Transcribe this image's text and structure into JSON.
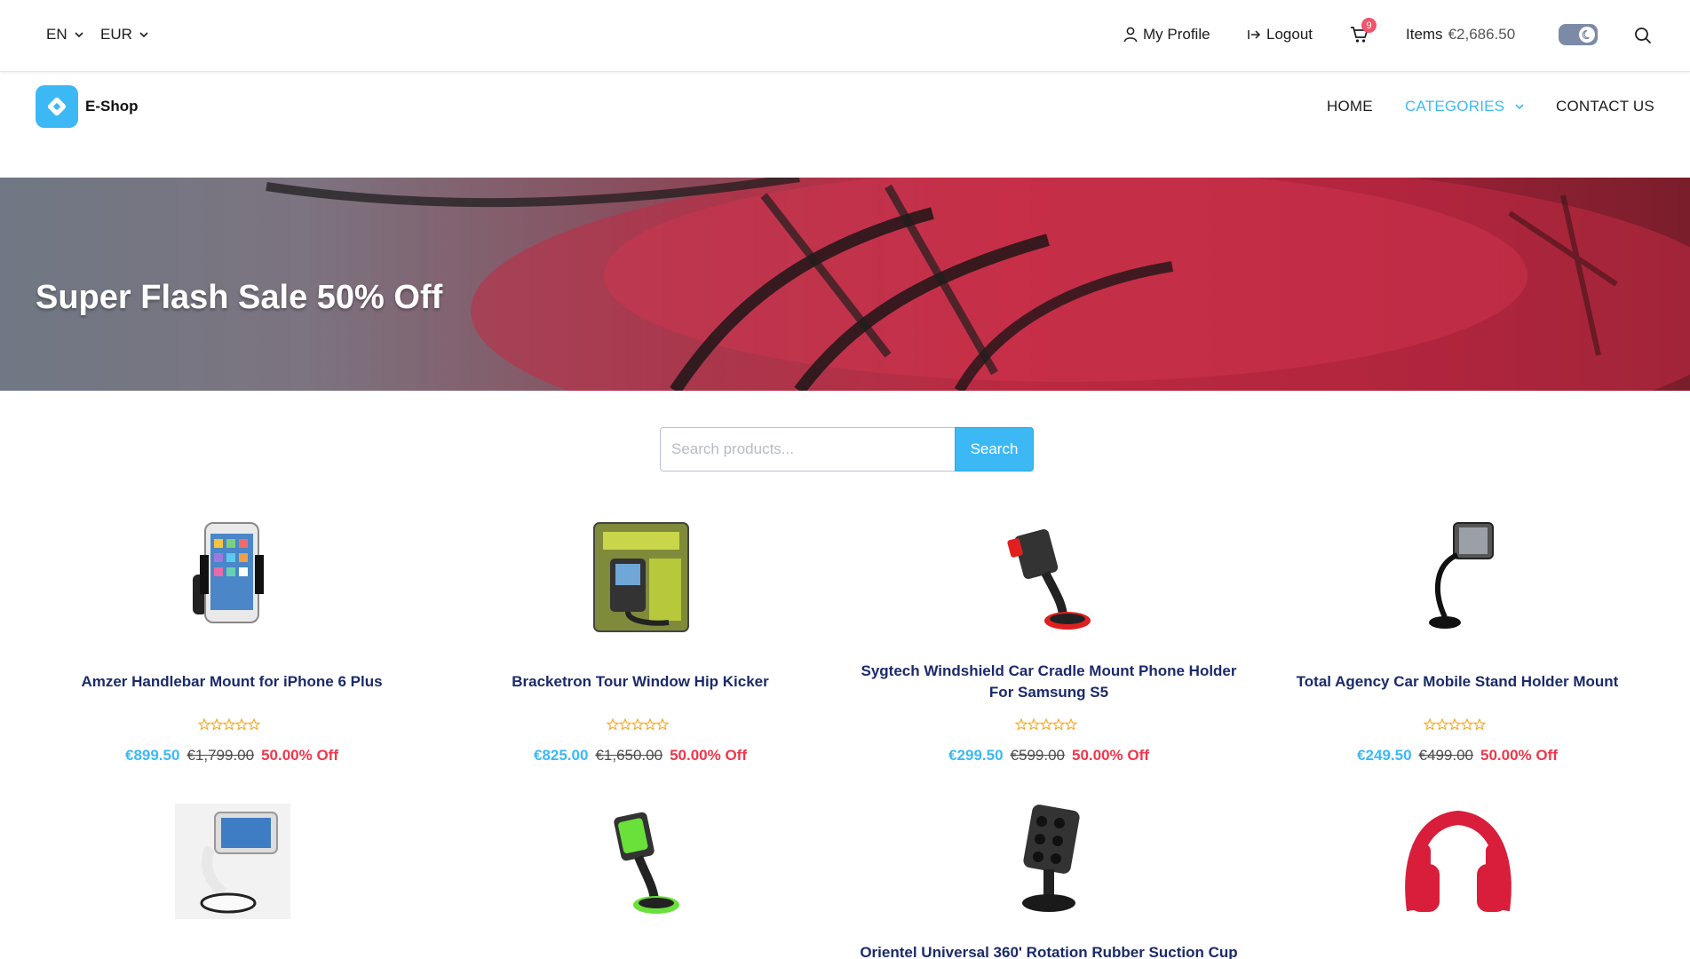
{
  "topbar": {
    "language": "EN",
    "currency": "EUR",
    "profile_label": "My Profile",
    "logout_label": "Logout",
    "cart_count": "9",
    "items_label": "Items",
    "items_total": "€2,686.50"
  },
  "header": {
    "logo_text": "E-Shop",
    "nav": {
      "home": "HOME",
      "categories": "CATEGORIES",
      "contact": "CONTACT US"
    }
  },
  "banner": {
    "title": "Super Flash Sale 50% Off"
  },
  "search": {
    "placeholder": "Search products...",
    "button_label": "Search"
  },
  "colors": {
    "accent": "#3cb9f5",
    "discount": "#f0374b",
    "title": "#1b2a6b",
    "badge": "#f0556b"
  },
  "products": [
    {
      "title": "Amzer Handlebar Mount for iPhone 6 Plus",
      "price": "€899.50",
      "old_price": "€1,799.00",
      "discount": "50.00% Off"
    },
    {
      "title": "Bracketron Tour Window Hip Kicker",
      "price": "€825.00",
      "old_price": "€1,650.00",
      "discount": "50.00% Off"
    },
    {
      "title": "Sygtech Windshield Car Cradle Mount Phone Holder For Samsung S5",
      "price": "€299.50",
      "old_price": "€599.00",
      "discount": "50.00% Off"
    },
    {
      "title": "Total Agency Car Mobile Stand Holder Mount",
      "price": "€249.50",
      "old_price": "€499.00",
      "discount": "50.00% Off"
    },
    {
      "title": "",
      "price": "",
      "old_price": "",
      "discount": ""
    },
    {
      "title": "",
      "price": "",
      "old_price": "",
      "discount": ""
    },
    {
      "title": "Orientel Universal 360' Rotation Rubber Suction Cup",
      "price": "",
      "old_price": "",
      "discount": ""
    },
    {
      "title": "",
      "price": "",
      "old_price": "",
      "discount": ""
    }
  ]
}
